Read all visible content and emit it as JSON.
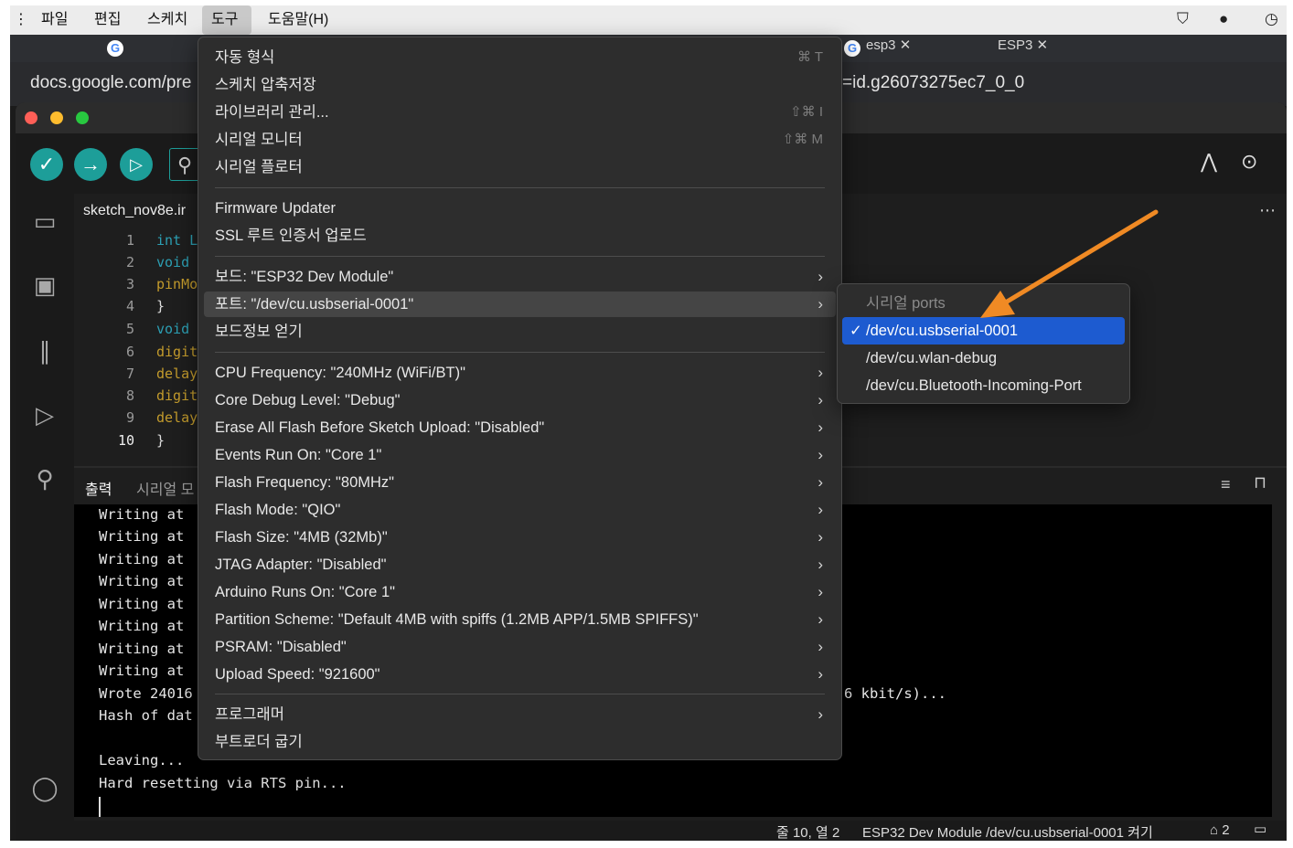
{
  "menubar": {
    "items": [
      "파일",
      "편집",
      "스케치",
      "도구",
      "도움말(H)"
    ],
    "active_index": 3
  },
  "browser": {
    "tabs": [
      "esp3",
      "ESP3"
    ],
    "url_left": "docs.google.com/pre",
    "url_right": "=id.g26073275ec7_0_0"
  },
  "editor": {
    "file_tab": "sketch_nov8e.ir",
    "line_numbers": [
      "1",
      "2",
      "3",
      "4",
      "5",
      "6",
      "7",
      "8",
      "9",
      "10"
    ],
    "code": [
      "int L",
      "void",
      "pinMo",
      "}",
      "void",
      "digit",
      "delay",
      "digit",
      "delay",
      "}"
    ]
  },
  "output": {
    "tab_output": "출력",
    "tab_serial": "시리얼 모",
    "lines": [
      "Writing at",
      "Writing at",
      "Writing at",
      "Writing at",
      "Writing at",
      "Writing at",
      "Writing at",
      "Writing at",
      "Wrote 24016",
      "Hash of dat",
      "",
      "Leaving...",
      "Hard resetting via RTS pin..."
    ],
    "right_fragment": "6 kbit/s)..."
  },
  "status": {
    "position": "줄 10, 열 2",
    "board": "ESP32 Dev Module /dev/cu.usbserial-0001 켜기",
    "notifications": "2"
  },
  "menu": {
    "items": [
      {
        "label": "자동 형식",
        "shortcut": "⌘ T"
      },
      {
        "label": "스케치 압축저장",
        "shortcut": ""
      },
      {
        "label": "라이브러리 관리...",
        "shortcut": "⇧⌘ I"
      },
      {
        "label": "시리얼 모니터",
        "shortcut": "⇧⌘ M"
      },
      {
        "label": "시리얼 플로터",
        "shortcut": ""
      },
      {
        "label": "Firmware Updater",
        "shortcut": ""
      },
      {
        "label": "SSL 루트 인증서 업로드",
        "shortcut": ""
      },
      {
        "label": "보드: \"ESP32 Dev Module\"",
        "submenu": true
      },
      {
        "label": "포트: \"/dev/cu.usbserial-0001\"",
        "submenu": true,
        "highlighted": true
      },
      {
        "label": "보드정보 얻기",
        "shortcut": ""
      },
      {
        "label": "CPU Frequency: \"240MHz (WiFi/BT)\"",
        "submenu": true
      },
      {
        "label": "Core Debug Level: \"Debug\"",
        "submenu": true
      },
      {
        "label": "Erase All Flash Before Sketch Upload: \"Disabled\"",
        "submenu": true
      },
      {
        "label": "Events Run On: \"Core 1\"",
        "submenu": true
      },
      {
        "label": "Flash Frequency: \"80MHz\"",
        "submenu": true
      },
      {
        "label": "Flash Mode: \"QIO\"",
        "submenu": true
      },
      {
        "label": "Flash Size: \"4MB (32Mb)\"",
        "submenu": true
      },
      {
        "label": "JTAG Adapter: \"Disabled\"",
        "submenu": true
      },
      {
        "label": "Arduino Runs On: \"Core 1\"",
        "submenu": true
      },
      {
        "label": "Partition Scheme: \"Default 4MB with spiffs (1.2MB APP/1.5MB SPIFFS)\"",
        "submenu": true
      },
      {
        "label": "PSRAM: \"Disabled\"",
        "submenu": true
      },
      {
        "label": "Upload Speed: \"921600\"",
        "submenu": true
      },
      {
        "label": "프로그래머",
        "submenu": true
      },
      {
        "label": "부트로더 굽기",
        "shortcut": ""
      }
    ]
  },
  "port_submenu": {
    "header": "시리얼 ports",
    "items": [
      "/dev/cu.usbserial-0001",
      "/dev/cu.wlan-debug",
      "/dev/cu.Bluetooth-Incoming-Port"
    ],
    "selected_index": 0,
    "check": "✓"
  },
  "colors": {
    "accent_teal": "#1d9e99",
    "selection_blue": "#1d5bd0",
    "annotation_arrow": "#f08a24"
  }
}
